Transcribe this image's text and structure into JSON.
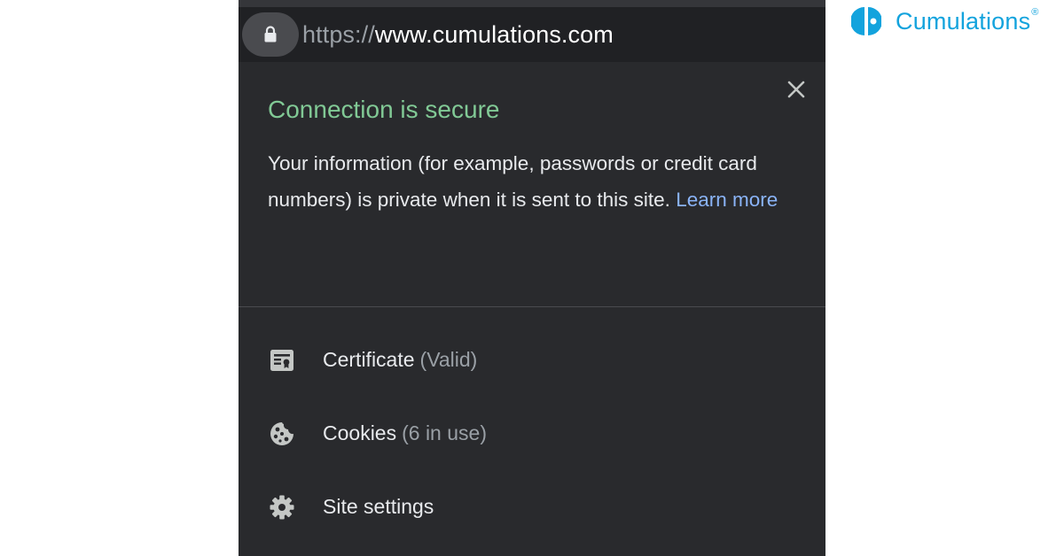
{
  "brand": {
    "name": "Cumulations",
    "registered_mark": "®",
    "color": "#13a3dd"
  },
  "address_bar": {
    "scheme": "https://",
    "host": "www.cumulations.com",
    "lock_icon": "lock-icon"
  },
  "popup": {
    "title": "Connection is secure",
    "title_color": "#81c995",
    "description": "Your information (for example, passwords or credit card numbers) is private when it is sent to this site.",
    "learn_more": "Learn more",
    "link_color": "#8ab4f8",
    "close_icon": "close-icon",
    "items": [
      {
        "icon": "certificate-icon",
        "label": "Certificate",
        "detail": "(Valid)"
      },
      {
        "icon": "cookie-icon",
        "label": "Cookies",
        "detail": "(6 in use)"
      },
      {
        "icon": "gear-icon",
        "label": "Site settings",
        "detail": ""
      }
    ]
  }
}
